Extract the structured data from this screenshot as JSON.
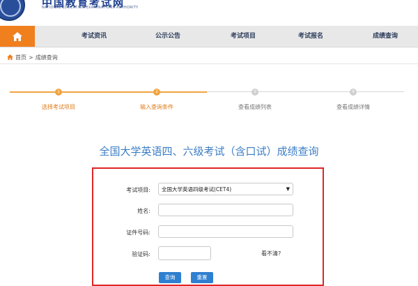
{
  "header": {
    "title": "中国教育考试网",
    "subtitle": "NATIONAL EDUCATION EXAMINATIONS AUTHORITY"
  },
  "nav": {
    "home_icon": "home-icon",
    "items": [
      "考试资讯",
      "公示公告",
      "考试项目",
      "考试报名",
      "成绩查询"
    ]
  },
  "breadcrumb": {
    "home": "首页",
    "separator": ">",
    "current": "成绩查询"
  },
  "steps": [
    {
      "number": "1",
      "label": "选择考试项目",
      "state": "active"
    },
    {
      "number": "2",
      "label": "输入查询条件",
      "state": "active"
    },
    {
      "number": "3",
      "label": "查看成绩列表",
      "state": "inactive"
    },
    {
      "number": "4",
      "label": "查看成绩详情",
      "state": "inactive"
    }
  ],
  "page_title": "全国大学英语四、六级考试（含口试）成绩查询",
  "form": {
    "exam_label": "考试项目:",
    "exam_value": "全国大学英语四级考试(CET4)",
    "name_label": "姓名:",
    "name_value": "",
    "id_label": "证件号码:",
    "id_value": "",
    "captcha_label": "验证码:",
    "captcha_value": "",
    "captcha_hint": "看不清?",
    "query_button": "查询",
    "reset_button": "重置"
  },
  "colors": {
    "accent_orange": "#f07f1e",
    "step_orange": "#f0a340",
    "title_blue": "#3b7dc4",
    "button_blue": "#2f7fd0",
    "form_border_red": "#e02424"
  }
}
